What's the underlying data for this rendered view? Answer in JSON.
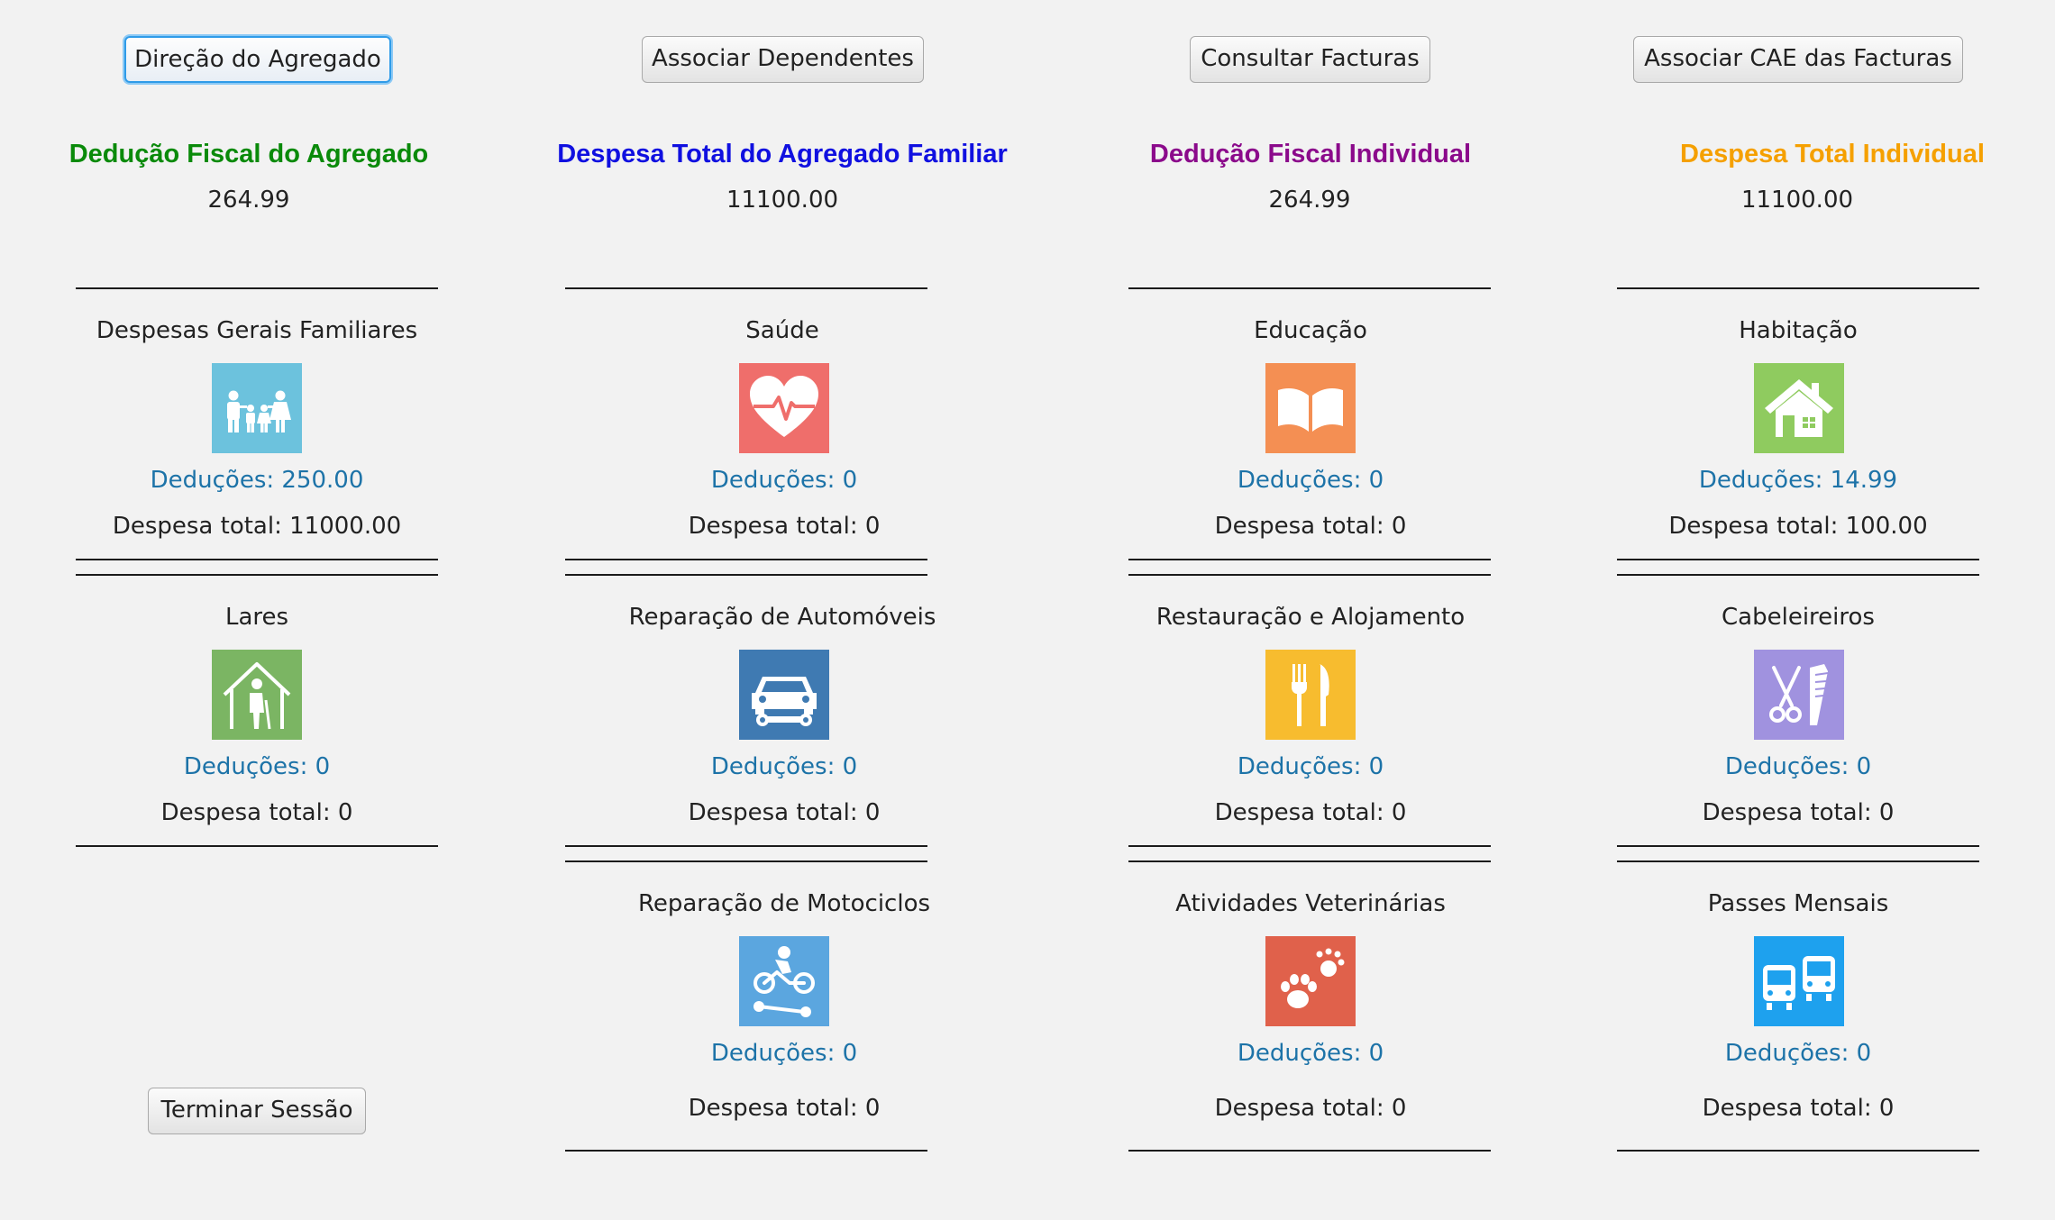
{
  "buttons": {
    "direcao": "Direção do Agregado",
    "dependentes": "Associar Dependentes",
    "facturas": "Consultar Facturas",
    "cae": "Associar CAE das Facturas",
    "terminar": "Terminar Sessão"
  },
  "summary": [
    {
      "title": "Dedução Fiscal do Agregado",
      "value": "264.99",
      "color": "#0a8a0a"
    },
    {
      "title": "Despesa Total do Agregado Familiar",
      "value": "11100.00",
      "color": "#1010e0"
    },
    {
      "title": "Dedução Fiscal Individual",
      "value": "264.99",
      "color": "#8b0a8b"
    },
    {
      "title": "Despesa Total Individual",
      "value": "11100.00",
      "color": "#f5a000"
    }
  ],
  "labels": {
    "deducoes_prefix": "Deduções: ",
    "despesa_prefix": "Despesa total: "
  },
  "categories": {
    "gerais": {
      "name": "Despesas Gerais Familiares",
      "deducoes": "Deduções: 250.00",
      "despesa": "Despesa total: 11000.00",
      "icon": "family-icon",
      "color": "#6cc2dd"
    },
    "saude": {
      "name": "Saúde",
      "deducoes": "Deduções: 0",
      "despesa": "Despesa total: 0",
      "icon": "heart-pulse-icon",
      "color": "#ef6e6b"
    },
    "educacao": {
      "name": "Educação",
      "deducoes": "Deduções: 0",
      "despesa": "Despesa total: 0",
      "icon": "book-icon",
      "color": "#f48f53"
    },
    "habitacao": {
      "name": "Habitação",
      "deducoes": "Deduções: 14.99",
      "despesa": "Despesa total: 100.00",
      "icon": "house-icon",
      "color": "#8fcb5f"
    },
    "lares": {
      "name": "Lares",
      "deducoes": "Deduções: 0",
      "despesa": "Despesa total: 0",
      "icon": "elderly-home-icon",
      "color": "#7bb563"
    },
    "automoveis": {
      "name": "Reparação de Automóveis",
      "deducoes": "Deduções: 0",
      "despesa": "Despesa total: 0",
      "icon": "car-repair-icon",
      "color": "#3f7ab2"
    },
    "restauracao": {
      "name": "Restauração e Alojamento",
      "deducoes": "Deduções: 0",
      "despesa": "Despesa total: 0",
      "icon": "fork-knife-icon",
      "color": "#f7bc2f"
    },
    "cabeleireiros": {
      "name": "Cabeleireiros",
      "deducoes": "Deduções: 0",
      "despesa": "Despesa total: 0",
      "icon": "scissors-comb-icon",
      "color": "#a092df"
    },
    "motociclos": {
      "name": "Reparação de Motociclos",
      "deducoes": "Deduções: 0",
      "despesa": "Despesa total: 0",
      "icon": "motorcycle-repair-icon",
      "color": "#5ba6df"
    },
    "veterinarias": {
      "name": "Atividades Veterinárias",
      "deducoes": "Deduções: 0",
      "despesa": "Despesa total: 0",
      "icon": "paw-icon",
      "color": "#e0614b"
    },
    "passes": {
      "name": "Passes Mensais",
      "deducoes": "Deduções: 0",
      "despesa": "Despesa total: 0",
      "icon": "train-bus-icon",
      "color": "#1ea1ee"
    }
  }
}
